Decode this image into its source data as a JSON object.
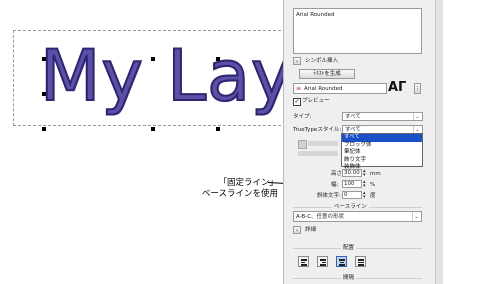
{
  "canvas": {
    "text": "My Lay"
  },
  "callout": {
    "line1": "「固定ライン」",
    "line2": "ベースラインを使用"
  },
  "panel": {
    "text_area_value": "Arial Rounded",
    "insert_symbol_label": "シンボル挿入",
    "generate_text_button": "ﾃｷｽﾄを生成",
    "font_name": "Arial Rounded",
    "font_preview": "AΓ",
    "preview_label": "プレビュー",
    "type_label": "タイプ:",
    "type_value": "すべて",
    "truetype_label": "TrueTypeスタイル:",
    "truetype_value": "すべて",
    "truetype_options": [
      "すべて",
      "ブロック体",
      "筆記体",
      "飾り文字",
      "装飾体"
    ],
    "height_label": "高さ:",
    "height_value": "30.00",
    "height_unit": "mm",
    "width_label": "幅:",
    "width_value": "100",
    "width_unit": "%",
    "slant_label": "斜体文字:",
    "slant_value": "0",
    "slant_unit": "度",
    "baseline_header": "ベースライン",
    "baseline_value": "A-B-C、任意の形状",
    "advanced_label": "詳細",
    "align_header": "配置",
    "spacing_header": "間隔"
  },
  "colors": {
    "text_fill": "#5a50a8",
    "selection_blue": "#1a4fc7"
  }
}
